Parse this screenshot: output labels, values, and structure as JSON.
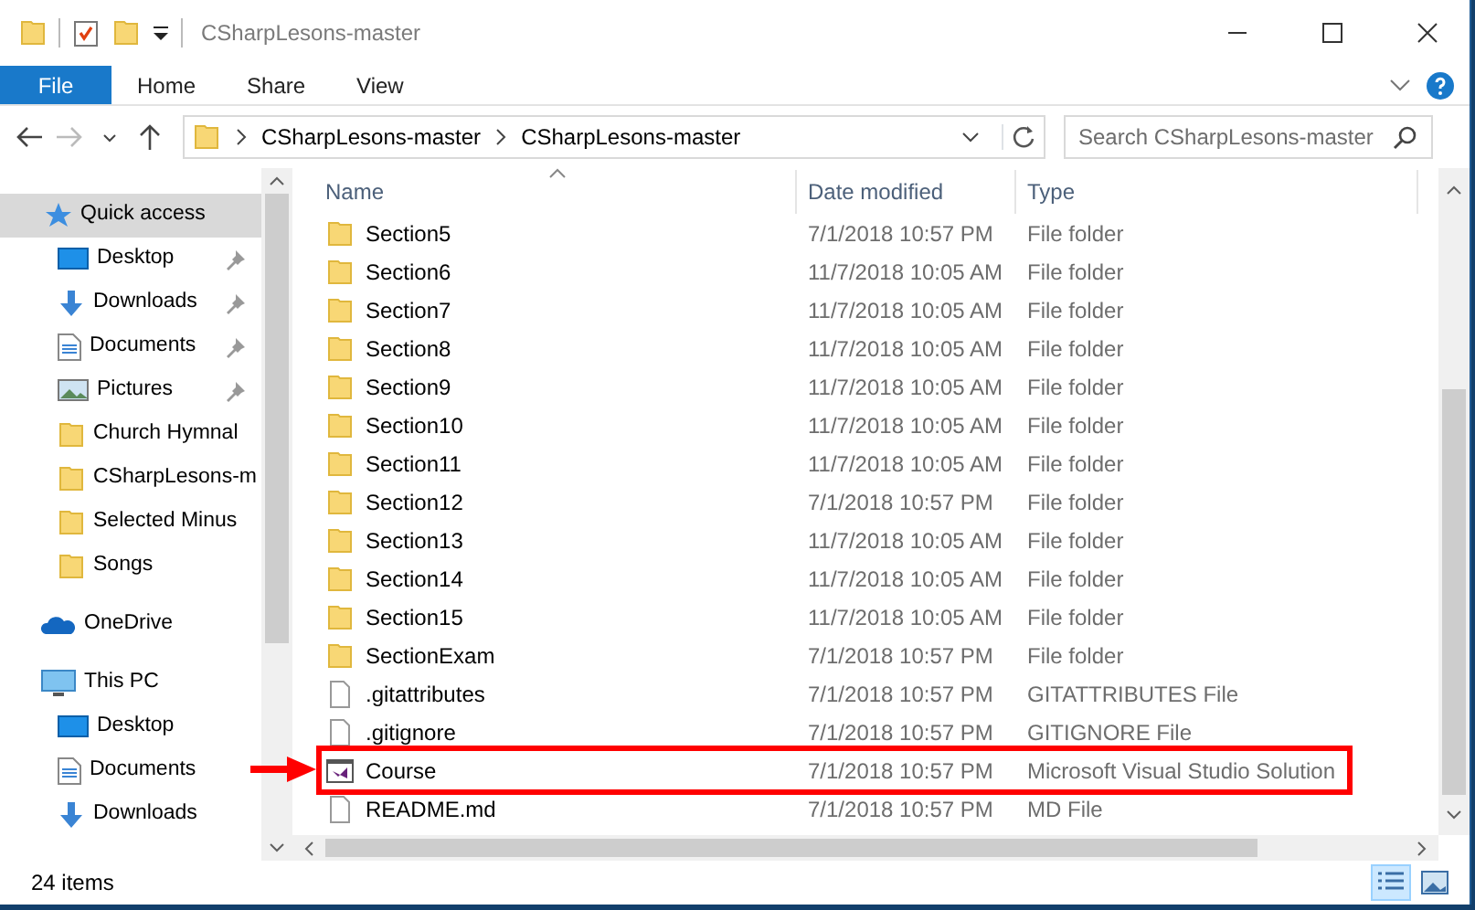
{
  "window": {
    "title": "CSharpLesons-master"
  },
  "ribbon_tabs": [
    {
      "label": "File",
      "kind": "backstage"
    },
    {
      "label": "Home",
      "kind": "tab"
    },
    {
      "label": "Share",
      "kind": "tab"
    },
    {
      "label": "View",
      "kind": "tab"
    }
  ],
  "address_bar": {
    "path": [
      "CSharpLesons-master",
      "CSharpLesons-master"
    ]
  },
  "search": {
    "placeholder": "Search CSharpLesons-master"
  },
  "sidebar": {
    "items": [
      {
        "label": "Quick access",
        "kind": "star",
        "selected": true,
        "children": [
          {
            "label": "Desktop",
            "kind": "desktop",
            "pinned": true,
            "selected": false
          },
          {
            "label": "Downloads",
            "kind": "download",
            "pinned": true,
            "selected": false
          },
          {
            "label": "Documents",
            "kind": "document",
            "pinned": true,
            "selected": false
          },
          {
            "label": "Pictures",
            "kind": "pictures",
            "pinned": true,
            "selected": false
          },
          {
            "label": "Church Hymnal",
            "kind": "folder",
            "pinned": false,
            "selected": false
          },
          {
            "label": "CSharpLesons-m",
            "kind": "folder",
            "pinned": false,
            "selected": false
          },
          {
            "label": "Selected Minus",
            "kind": "folder",
            "pinned": false,
            "selected": false
          },
          {
            "label": "Songs",
            "kind": "folder",
            "pinned": false,
            "selected": false
          }
        ]
      },
      {
        "label": "OneDrive",
        "kind": "cloud",
        "selected": false
      },
      {
        "label": "This PC",
        "kind": "pc",
        "selected": false,
        "children": [
          {
            "label": "Desktop",
            "kind": "desktop",
            "pinned": false,
            "selected": false
          },
          {
            "label": "Documents",
            "kind": "document",
            "pinned": false,
            "selected": false
          },
          {
            "label": "Downloads",
            "kind": "download",
            "pinned": false,
            "selected": false
          }
        ]
      }
    ]
  },
  "table": {
    "columns": [
      "Name",
      "Date modified",
      "Type"
    ],
    "rows": [
      {
        "name": "Section5",
        "date_modified": "7/1/2018 10:57 PM",
        "type": "File folder",
        "kind": "folder",
        "highlighted": false
      },
      {
        "name": "Section6",
        "date_modified": "11/7/2018 10:05 AM",
        "type": "File folder",
        "kind": "folder",
        "highlighted": false
      },
      {
        "name": "Section7",
        "date_modified": "11/7/2018 10:05 AM",
        "type": "File folder",
        "kind": "folder",
        "highlighted": false
      },
      {
        "name": "Section8",
        "date_modified": "11/7/2018 10:05 AM",
        "type": "File folder",
        "kind": "folder",
        "highlighted": false
      },
      {
        "name": "Section9",
        "date_modified": "11/7/2018 10:05 AM",
        "type": "File folder",
        "kind": "folder",
        "highlighted": false
      },
      {
        "name": "Section10",
        "date_modified": "11/7/2018 10:05 AM",
        "type": "File folder",
        "kind": "folder",
        "highlighted": false
      },
      {
        "name": "Section11",
        "date_modified": "11/7/2018 10:05 AM",
        "type": "File folder",
        "kind": "folder",
        "highlighted": false
      },
      {
        "name": "Section12",
        "date_modified": "7/1/2018 10:57 PM",
        "type": "File folder",
        "kind": "folder",
        "highlighted": false
      },
      {
        "name": "Section13",
        "date_modified": "11/7/2018 10:05 AM",
        "type": "File folder",
        "kind": "folder",
        "highlighted": false
      },
      {
        "name": "Section14",
        "date_modified": "11/7/2018 10:05 AM",
        "type": "File folder",
        "kind": "folder",
        "highlighted": false
      },
      {
        "name": "Section15",
        "date_modified": "11/7/2018 10:05 AM",
        "type": "File folder",
        "kind": "folder",
        "highlighted": false
      },
      {
        "name": "SectionExam",
        "date_modified": "7/1/2018 10:57 PM",
        "type": "File folder",
        "kind": "folder",
        "highlighted": false
      },
      {
        "name": ".gitattributes",
        "date_modified": "7/1/2018 10:57 PM",
        "type": "GITATTRIBUTES File",
        "kind": "file",
        "highlighted": false
      },
      {
        "name": ".gitignore",
        "date_modified": "7/1/2018 10:57 PM",
        "type": "GITIGNORE File",
        "kind": "file",
        "highlighted": false
      },
      {
        "name": "Course",
        "date_modified": "7/1/2018 10:57 PM",
        "type": "Microsoft Visual Studio Solution",
        "kind": "solution",
        "highlighted": true
      },
      {
        "name": "README.md",
        "date_modified": "7/1/2018 10:57 PM",
        "type": "MD File",
        "kind": "file",
        "highlighted": false
      }
    ]
  },
  "status_bar": {
    "item_count": "24 items"
  },
  "view_buttons": [
    {
      "kind": "details",
      "selected": true
    },
    {
      "kind": "large-icons",
      "selected": false
    }
  ]
}
